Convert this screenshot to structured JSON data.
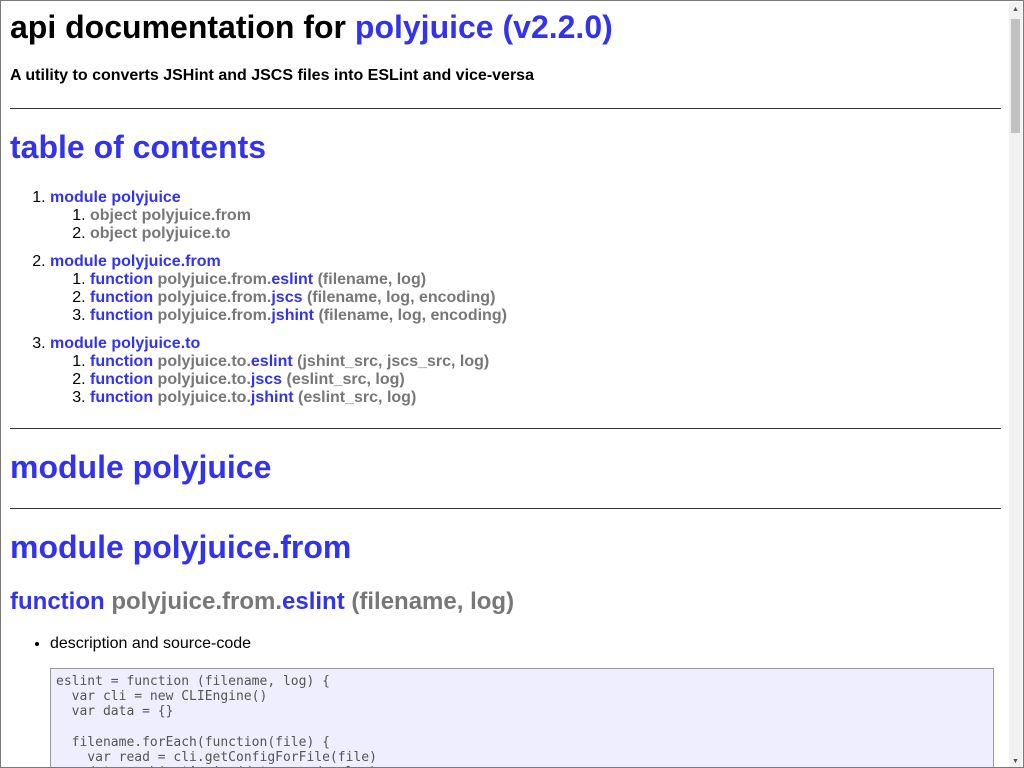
{
  "header": {
    "title_prefix": "api documentation for",
    "title_link": "polyjuice (v2.2.0)",
    "subtitle": "A utility to converts JSHint and JSCS files into ESLint and vice-versa"
  },
  "toc": {
    "heading": "table of contents",
    "modules": [
      {
        "label": "module polyjuice",
        "items": [
          {
            "kind": "object",
            "name": "polyjuice.from",
            "member": "",
            "args": ""
          },
          {
            "kind": "object",
            "name": "polyjuice.to",
            "member": "",
            "args": ""
          }
        ]
      },
      {
        "label": "module polyjuice.from",
        "items": [
          {
            "kind": "function",
            "name": "polyjuice.from.",
            "member": "eslint",
            "args": "(filename, log)"
          },
          {
            "kind": "function",
            "name": "polyjuice.from.",
            "member": "jscs",
            "args": "(filename, log, encoding)"
          },
          {
            "kind": "function",
            "name": "polyjuice.from.",
            "member": "jshint",
            "args": "(filename, log, encoding)"
          }
        ]
      },
      {
        "label": "module polyjuice.to",
        "items": [
          {
            "kind": "function",
            "name": "polyjuice.to.",
            "member": "eslint",
            "args": "(jshint_src, jscs_src, log)"
          },
          {
            "kind": "function",
            "name": "polyjuice.to.",
            "member": "jscs",
            "args": "(eslint_src, log)"
          },
          {
            "kind": "function",
            "name": "polyjuice.to.",
            "member": "jshint",
            "args": "(eslint_src, log)"
          }
        ]
      }
    ]
  },
  "sections": {
    "module_polyjuice": "module polyjuice",
    "module_from": "module polyjuice.from"
  },
  "function_heading": {
    "kind": "function",
    "name": "polyjuice.from.",
    "member": "eslint",
    "args": "(filename, log)"
  },
  "description_label": "description and source-code",
  "code": "eslint = function (filename, log) {\n  var cli = new CLIEngine()\n  var data = {}\n\n  filename.forEach(function(file) {\n    var read = cli.getConfigForFile(file)\n    data = objectAssign(data, read.rules)"
}
